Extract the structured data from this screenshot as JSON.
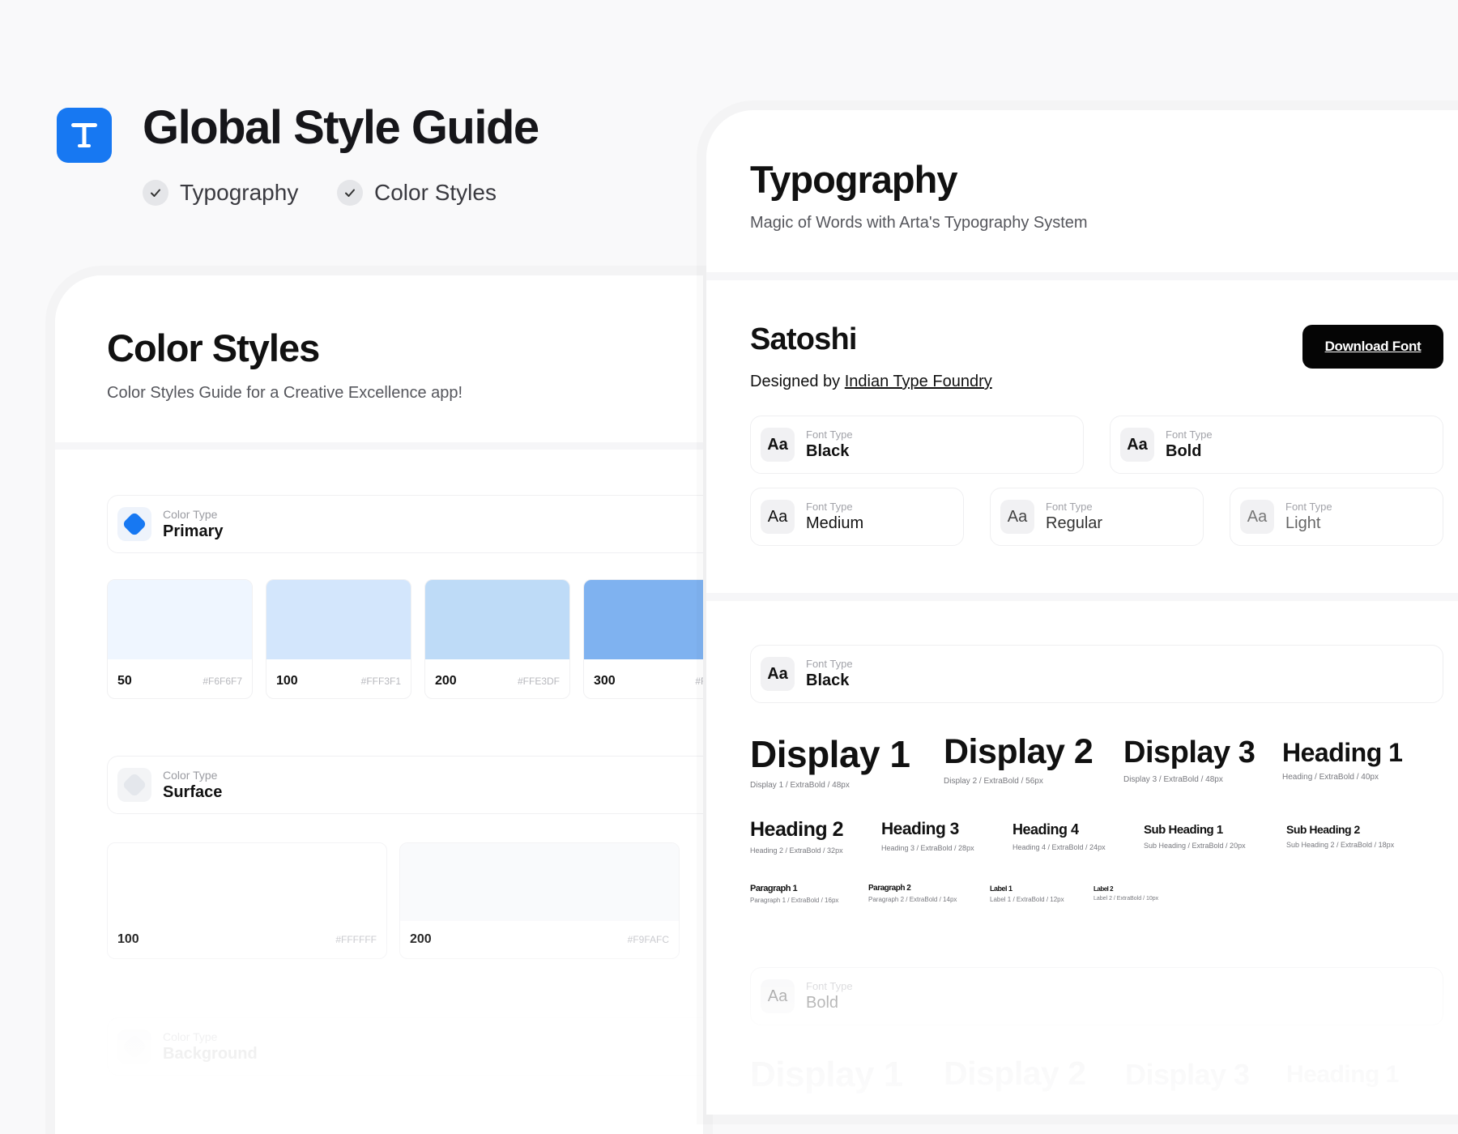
{
  "header": {
    "title": "Global Style Guide",
    "tags": [
      {
        "label": "Typography"
      },
      {
        "label": "Color Styles"
      }
    ]
  },
  "color_styles": {
    "title": "Color Styles",
    "subtitle": "Color Styles Guide for a Creative Excellence app!",
    "types": [
      {
        "caption": "Color Type",
        "name": "Primary",
        "icon_color": "#1778f2",
        "swatches": [
          {
            "step": "50",
            "hex": "#F6F6F7",
            "color": "#eff6ff"
          },
          {
            "step": "100",
            "hex": "#FFF3F1",
            "color": "#d3e6fc"
          },
          {
            "step": "200",
            "hex": "#FFE3DF",
            "color": "#bedbf7"
          },
          {
            "step": "300",
            "hex": "#FFA",
            "color": "#7fb2f0"
          }
        ]
      },
      {
        "caption": "Color Type",
        "name": "Surface",
        "icon_color": "#e4e7ec",
        "swatches": [
          {
            "step": "100",
            "hex": "#FFFFFF",
            "color": "#ffffff"
          },
          {
            "step": "200",
            "hex": "#F9FAFC",
            "color": "#f9fafc"
          }
        ]
      },
      {
        "caption": "Color Type",
        "name": "Background",
        "icon_color": "#eeeeef"
      }
    ]
  },
  "typography": {
    "title": "Typography",
    "subtitle": "Magic of Words with Arta's Typography System",
    "font_name": "Satoshi",
    "designed_by_prefix": "Designed by",
    "designer": "Indian Type Foundry",
    "download_label": "Download Font",
    "font_types": [
      {
        "aa": "Aa",
        "caption": "Font Type",
        "name": "Black"
      },
      {
        "aa": "Aa",
        "caption": "Font Type",
        "name": "Bold"
      },
      {
        "aa": "Aa",
        "caption": "Font Type",
        "name": "Medium"
      },
      {
        "aa": "Aa",
        "caption": "Font Type",
        "name": "Regular"
      },
      {
        "aa": "Aa",
        "caption": "Font Type",
        "name": "Light"
      }
    ],
    "black_section": {
      "aa": "Aa",
      "caption": "Font Type",
      "name": "Black",
      "styles": [
        {
          "label": "Display 1",
          "meta": "Display 1 / ExtraBold / 48px"
        },
        {
          "label": "Display 2",
          "meta": "Display 2 / ExtraBold / 56px"
        },
        {
          "label": "Display 3",
          "meta": "Display 3 / ExtraBold / 48px"
        },
        {
          "label": "Heading 1",
          "meta": "Heading / ExtraBold / 40px"
        },
        {
          "label": "Heading 2",
          "meta": "Heading 2 / ExtraBold / 32px"
        },
        {
          "label": "Heading 3",
          "meta": "Heading 3 / ExtraBold / 28px"
        },
        {
          "label": "Heading 4",
          "meta": "Heading 4 / ExtraBold / 24px"
        },
        {
          "label": "Sub Heading 1",
          "meta": "Sub Heading / ExtraBold / 20px"
        },
        {
          "label": "Sub Heading 2",
          "meta": "Sub Heading 2 / ExtraBold / 18px"
        },
        {
          "label": "Paragraph 1",
          "meta": "Paragraph 1 / ExtraBold / 16px"
        },
        {
          "label": "Paragraph 2",
          "meta": "Paragraph 2 / ExtraBold / 14px"
        },
        {
          "label": "Label 1",
          "meta": "Label 1 / ExtraBold / 12px"
        },
        {
          "label": "Label 2",
          "meta": "Label 2 / ExtraBold / 10px"
        }
      ]
    },
    "bold_section": {
      "aa": "Aa",
      "caption": "Font Type",
      "name": "Bold",
      "styles": [
        {
          "label": "Display 1"
        },
        {
          "label": "Display 2"
        },
        {
          "label": "Display 3"
        },
        {
          "label": "Heading 1"
        }
      ]
    }
  }
}
